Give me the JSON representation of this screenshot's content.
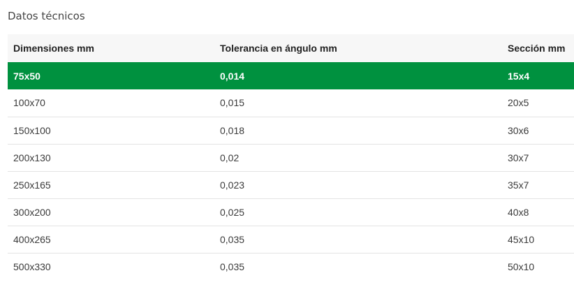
{
  "title": "Datos técnicos",
  "colors": {
    "highlight_row": "#00913f",
    "header_bg": "#f7f7f7",
    "row_divider": "#e3e3e3"
  },
  "table": {
    "headers": [
      "Dimensiones mm",
      "Tolerancia en ángulo mm",
      "Sección mm"
    ],
    "highlighted_row_index": 0,
    "rows": [
      [
        "75x50",
        "0,014",
        "15x4"
      ],
      [
        "100x70",
        "0,015",
        "20x5"
      ],
      [
        "150x100",
        "0,018",
        "30x6"
      ],
      [
        "200x130",
        "0,02",
        "30x7"
      ],
      [
        "250x165",
        "0,023",
        "35x7"
      ],
      [
        "300x200",
        "0,025",
        "40x8"
      ],
      [
        "400x265",
        "0,035",
        "45x10"
      ],
      [
        "500x330",
        "0,035",
        "50x10"
      ]
    ]
  }
}
